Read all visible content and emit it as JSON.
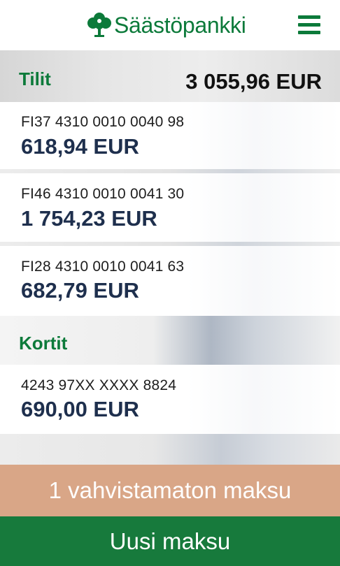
{
  "header": {
    "logo_text": "Säästöpankki",
    "brand_color": "#0c7a3a",
    "logo_icon": "tree-logo-icon",
    "menu_icon": "hamburger-menu-icon"
  },
  "accounts": {
    "title": "Tilit",
    "total": "3 055,96 EUR",
    "items": [
      {
        "number": "FI37 4310 0010 0040 98",
        "balance": "618,94 EUR"
      },
      {
        "number": "FI46 4310 0010 0041 30",
        "balance": "1 754,23 EUR"
      },
      {
        "number": "FI28 4310 0010 0041 63",
        "balance": "682,79 EUR"
      }
    ]
  },
  "cards": {
    "title": "Kortit",
    "items": [
      {
        "number": "4243 97XX XXXX 8824",
        "balance": "690,00 EUR"
      }
    ]
  },
  "actions": {
    "pending_label": "1 vahvistamaton maksu",
    "pending_color": "#d9a687",
    "new_payment_label": "Uusi maksu",
    "new_payment_color": "#177a3c"
  }
}
